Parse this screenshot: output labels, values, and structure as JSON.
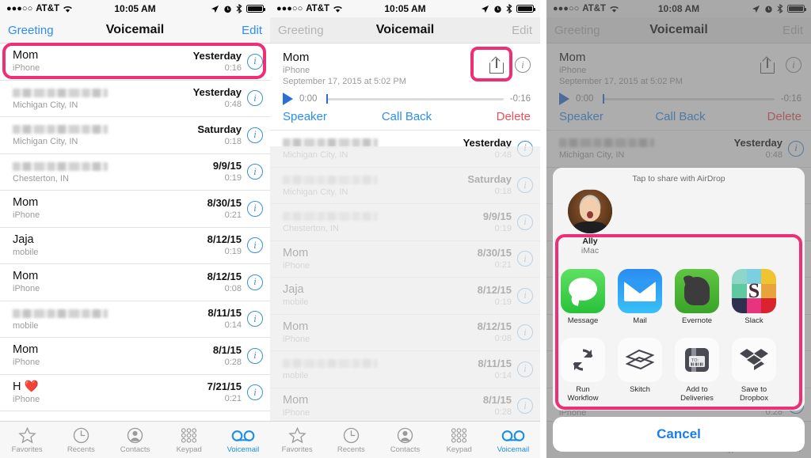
{
  "statusbar": {
    "signal_dots": "●●●○○",
    "carrier": "AT&T",
    "wifi_icon": "wifi-icon",
    "time_p1": "10:05 AM",
    "time_p2": "10:05 AM",
    "time_p3": "10:08 AM",
    "location_icon": "location-arrow-icon",
    "alarm_icon": "alarm-clock-icon",
    "bluetooth_icon": "bluetooth-icon",
    "battery_icon": "battery-icon"
  },
  "navbar": {
    "left": "Greeting",
    "title": "Voicemail",
    "right": "Edit"
  },
  "colors": {
    "highlight_pink": "#ef2e78",
    "tint_blue": "#2b8ef0",
    "delete_red": "#e8505b",
    "active_tab": "#1b8fe0"
  },
  "voicemails": [
    {
      "name": "Mom",
      "blurred": false,
      "sub": "iPhone",
      "date": "Yesterday",
      "duration": "0:16",
      "selected": true
    },
    {
      "name": "",
      "blurred": true,
      "sub": "Michigan City, IN",
      "date": "Yesterday",
      "duration": "0:48"
    },
    {
      "name": "",
      "blurred": true,
      "sub": "Michigan City, IN",
      "date": "Saturday",
      "duration": "0:18"
    },
    {
      "name": "",
      "blurred": true,
      "sub": "Chesterton, IN",
      "date": "9/9/15",
      "duration": "0:19"
    },
    {
      "name": "Mom",
      "blurred": false,
      "sub": "iPhone",
      "date": "8/30/15",
      "duration": "0:21"
    },
    {
      "name": "Jaja",
      "blurred": false,
      "sub": "mobile",
      "date": "8/12/15",
      "duration": "0:19"
    },
    {
      "name": "Mom",
      "blurred": false,
      "sub": "iPhone",
      "date": "8/12/15",
      "duration": "0:08"
    },
    {
      "name": "",
      "blurred": true,
      "sub": "mobile",
      "date": "8/11/15",
      "duration": "0:14"
    },
    {
      "name": "Mom",
      "blurred": false,
      "sub": "iPhone",
      "date": "8/1/15",
      "duration": "0:28"
    },
    {
      "name": "H ❤️",
      "blurred": false,
      "sub": "iPhone",
      "date": "7/21/15",
      "duration": "0:21"
    }
  ],
  "expanded": {
    "name": "Mom",
    "sub_device": "iPhone",
    "sub_date": "September 17, 2015 at 5:02 PM",
    "share_icon": "share-icon",
    "info_icon": "info-icon",
    "play_icon": "play-icon",
    "elapsed": "0:00",
    "remaining": "-0:16",
    "speaker": "Speaker",
    "call_back": "Call Back",
    "delete": "Delete"
  },
  "tabbar": [
    {
      "label": "Favorites",
      "icon": "star-icon",
      "active": false
    },
    {
      "label": "Recents",
      "icon": "clock-icon",
      "active": false
    },
    {
      "label": "Contacts",
      "icon": "person-circle-icon",
      "active": false
    },
    {
      "label": "Keypad",
      "icon": "keypad-dots-icon",
      "active": false
    },
    {
      "label": "Voicemail",
      "icon": "voicemail-icon",
      "active": true
    }
  ],
  "share_sheet": {
    "airdrop_title": "Tap to share with AirDrop",
    "airdrop_person": {
      "name": "Ally",
      "device": "iMac",
      "avatar": "contact-photo"
    },
    "apps": [
      {
        "label": "Message",
        "icon": "messages-app-icon"
      },
      {
        "label": "Mail",
        "icon": "mail-app-icon"
      },
      {
        "label": "Evernote",
        "icon": "evernote-app-icon"
      },
      {
        "label": "Slack",
        "icon": "slack-app-icon"
      }
    ],
    "actions": [
      {
        "label": "Run Workflow",
        "icon": "workflow-icon"
      },
      {
        "label": "Skitch",
        "icon": "skitch-icon"
      },
      {
        "label": "Add to Deliveries",
        "icon": "deliveries-icon"
      },
      {
        "label": "Save to Dropbox",
        "icon": "dropbox-icon"
      }
    ],
    "cancel": "Cancel"
  }
}
